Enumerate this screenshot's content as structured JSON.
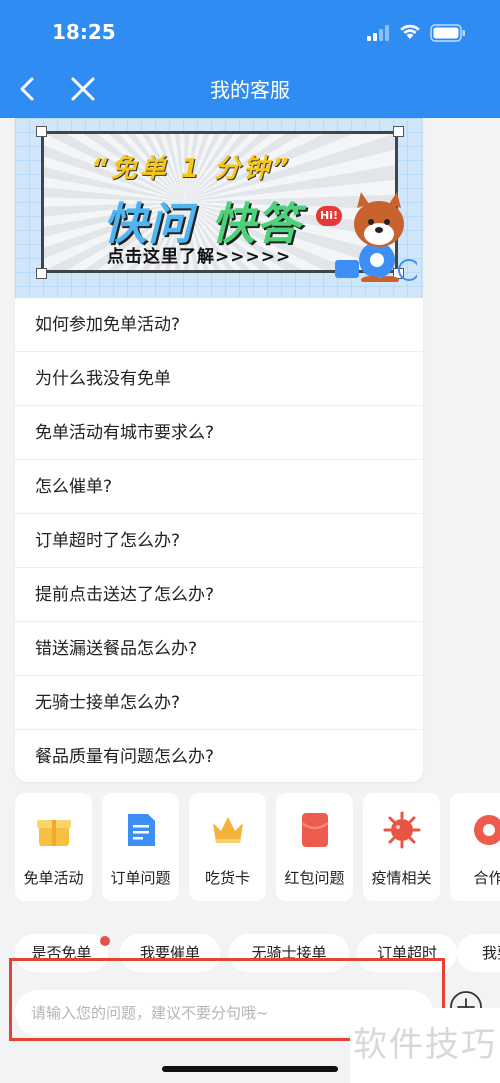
{
  "status_bar": {
    "time": "18:25"
  },
  "nav": {
    "title": "我的客服"
  },
  "banner": {
    "quote": "“免单 1 分钟”",
    "headline_a": "快问",
    "headline_b": "快答",
    "subline": "点击这里了解>>>>>",
    "badge": "Hi!"
  },
  "faq": [
    "如何参加免单活动?",
    "为什么我没有免单",
    "免单活动有城市要求么?",
    "怎么催单?",
    "订单超时了怎么办?",
    "提前点击送达了怎么办?",
    "错送漏送餐品怎么办?",
    "无骑士接单怎么办?",
    "餐品质量有问题怎么办?"
  ],
  "shortcuts": [
    {
      "label": "免单活动",
      "icon": "gift-icon",
      "color": "#f6c143"
    },
    {
      "label": "订单问题",
      "icon": "document-icon",
      "color": "#3d8ff5"
    },
    {
      "label": "吃货卡",
      "icon": "crown-icon",
      "color": "#f5b23a"
    },
    {
      "label": "红包问题",
      "icon": "red-envelope-icon",
      "color": "#ec5b4b"
    },
    {
      "label": "疫情相关",
      "icon": "virus-icon",
      "color": "#e85643"
    },
    {
      "label": "合作",
      "icon": "cooperation-icon",
      "color": "#ec5b4b"
    }
  ],
  "chips": [
    "是否免单",
    "我要催单",
    "无骑士接单",
    "订单超时",
    "我要"
  ],
  "input": {
    "placeholder": "请输入您的问题，建议不要分句哦~"
  },
  "watermark": "软件技巧"
}
